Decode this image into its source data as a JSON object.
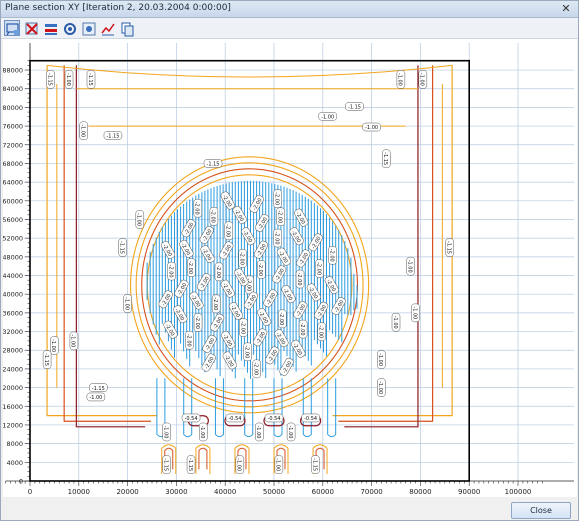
{
  "window": {
    "title": "Plane section XY [Iteration 2, 20.03.2004 0:00:00]",
    "close_glyph": "✕"
  },
  "toolbar": {
    "buttons": [
      {
        "icon": "zoom-region-icon",
        "active": true
      },
      {
        "icon": "delete-grid-icon",
        "active": false
      },
      {
        "icon": "section-lines-icon",
        "active": false
      },
      {
        "icon": "layers-icon",
        "active": false
      },
      {
        "icon": "settings-icon",
        "active": false
      },
      {
        "icon": "legend-icon",
        "active": false
      },
      {
        "icon": "chart-icon",
        "active": false
      },
      {
        "icon": "copy-icon",
        "active": false
      }
    ]
  },
  "plot": {
    "x_ticks": [
      "0",
      "10000",
      "20000",
      "30000",
      "40000",
      "50000",
      "60000",
      "70000",
      "80000",
      "90000",
      "100000"
    ],
    "y_ticks": [
      "0",
      "4000",
      "8000",
      "12000",
      "16000",
      "20000",
      "24000",
      "28000",
      "32000",
      "36000",
      "40000",
      "44000",
      "48000",
      "52000",
      "56000",
      "60000",
      "64000",
      "68000",
      "72000",
      "76000",
      "80000",
      "84000",
      "88000"
    ],
    "colors": {
      "background": "#ffffff",
      "grid": "#b7c9e2",
      "frame": "#000000",
      "contour_orange": "#f2a51c",
      "contour_red": "#d8501b",
      "contour_darkred": "#8c1a22",
      "contour_blue": "#2b9ce0"
    },
    "labels": [
      "-1.15",
      "-1.00",
      "-0.54",
      "-2.00"
    ]
  },
  "statusbar": {
    "close_label": "Close"
  }
}
